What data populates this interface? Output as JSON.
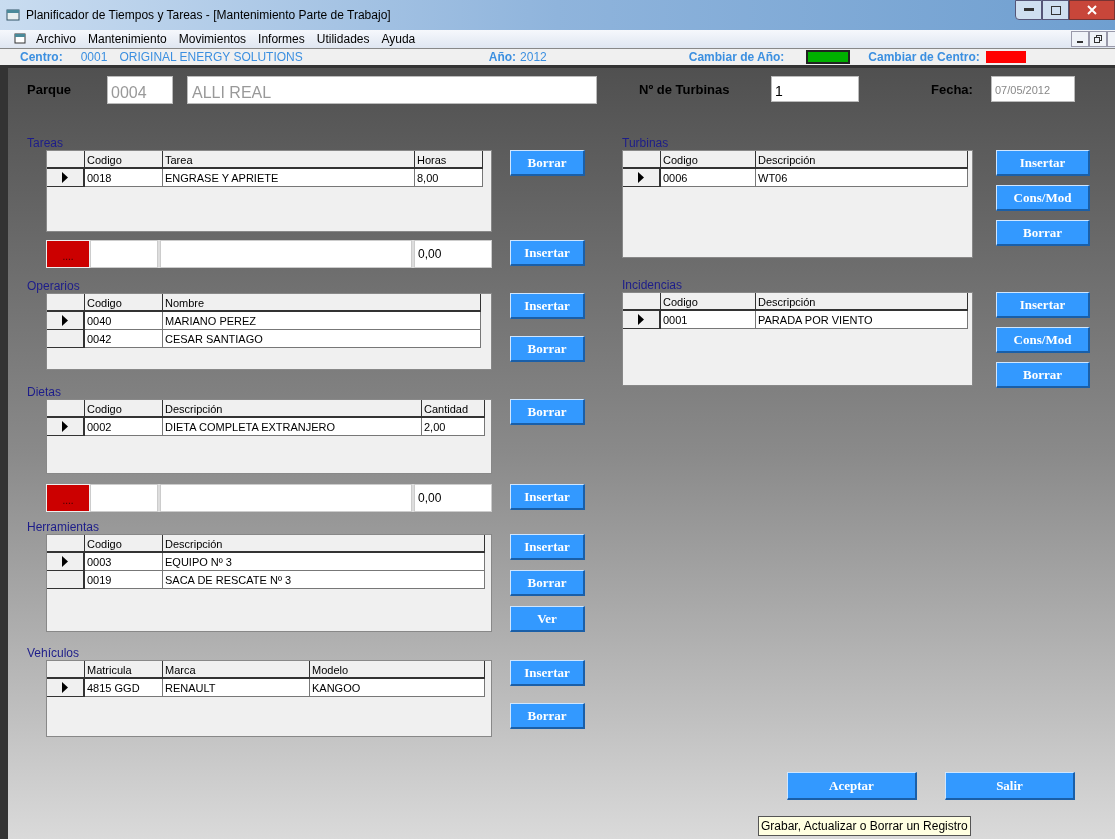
{
  "window": {
    "title": "Planificador de Tiempos y Tareas - [Mantenimiento Parte de Trabajo]"
  },
  "menu": [
    "Archivo",
    "Mantenimiento",
    "Movimientos",
    "Informes",
    "Utilidades",
    "Ayuda"
  ],
  "info_bar": {
    "centro_label": "Centro:",
    "centro_code": "0001",
    "centro_name": "ORIGINAL ENERGY SOLUTIONS",
    "year_label": "Año:",
    "year": "2012",
    "change_year_label": "Cambiar de Año:",
    "change_center_label": "Cambiar de Centro:"
  },
  "header": {
    "parque_label": "Parque",
    "parque_code": "0004",
    "parque_name": "ALLI REAL",
    "turbines_label": "Nº de Turbinas",
    "turbines_value": "1",
    "date_label": "Fecha:",
    "date_value": "07/05/2012"
  },
  "left_sections": [
    {
      "kind": "table",
      "title": "Tareas",
      "columns": [
        "Codigo",
        "Tarea",
        "Horas"
      ],
      "rows": [
        {
          "cells": [
            "0018",
            "ENGRASE Y APRIETE",
            "8,00"
          ],
          "selected": true
        }
      ],
      "buttons": [
        "Borrar"
      ]
    },
    {
      "kind": "entry",
      "picker": "....",
      "amount": "0,00",
      "buttons": [
        "Insertar"
      ]
    },
    {
      "kind": "table",
      "title": "Operarios",
      "columns": [
        "Codigo",
        "Nombre"
      ],
      "rows": [
        {
          "cells": [
            "0040",
            "MARIANO PEREZ"
          ],
          "selected": true
        },
        {
          "cells": [
            "0042",
            "CESAR SANTIAGO"
          ],
          "selected": false
        }
      ],
      "buttons": [
        "Insertar",
        "Borrar"
      ]
    },
    {
      "kind": "table",
      "title": "Dietas",
      "columns": [
        "Codigo",
        "Descripción",
        "Cantidad"
      ],
      "rows": [
        {
          "cells": [
            "0002",
            "DIETA COMPLETA EXTRANJERO",
            "2,00"
          ],
          "selected": true
        }
      ],
      "buttons": [
        "Borrar"
      ]
    },
    {
      "kind": "entry",
      "picker": "....",
      "amount": "0,00",
      "buttons": [
        "Insertar"
      ]
    },
    {
      "kind": "table",
      "title": "Herramientas",
      "columns": [
        "Codigo",
        "Descripción"
      ],
      "rows": [
        {
          "cells": [
            "0003",
            "EQUIPO Nº 3"
          ],
          "selected": true
        },
        {
          "cells": [
            "0019",
            "SACA DE RESCATE Nº 3"
          ],
          "selected": false
        }
      ],
      "buttons": [
        "Insertar",
        "Borrar",
        "Ver"
      ]
    },
    {
      "kind": "table",
      "title": "Vehículos",
      "columns": [
        "Matricula",
        "Marca",
        "Modelo"
      ],
      "rows": [
        {
          "cells": [
            "4815 GGD",
            "RENAULT",
            "KANGOO"
          ],
          "selected": true
        }
      ],
      "buttons": [
        "Insertar",
        "Borrar"
      ]
    }
  ],
  "right_sections": [
    {
      "kind": "table",
      "title": "Turbinas",
      "columns": [
        "Codigo",
        "Descripción"
      ],
      "rows": [
        {
          "cells": [
            "0006",
            "WT06"
          ],
          "selected": true
        }
      ],
      "buttons": [
        "Insertar",
        "Cons/Mod",
        "Borrar"
      ]
    },
    {
      "kind": "table",
      "title": "Incidencias",
      "columns": [
        "Codigo",
        "Descripción"
      ],
      "rows": [
        {
          "cells": [
            "0001",
            "PARADA POR VIENTO"
          ],
          "selected": true
        }
      ],
      "buttons": [
        "Insertar",
        "Cons/Mod",
        "Borrar"
      ]
    }
  ],
  "footer_buttons": [
    "Aceptar",
    "Salir"
  ],
  "tooltip": "Grabar, Actualizar o Borrar un Registro"
}
